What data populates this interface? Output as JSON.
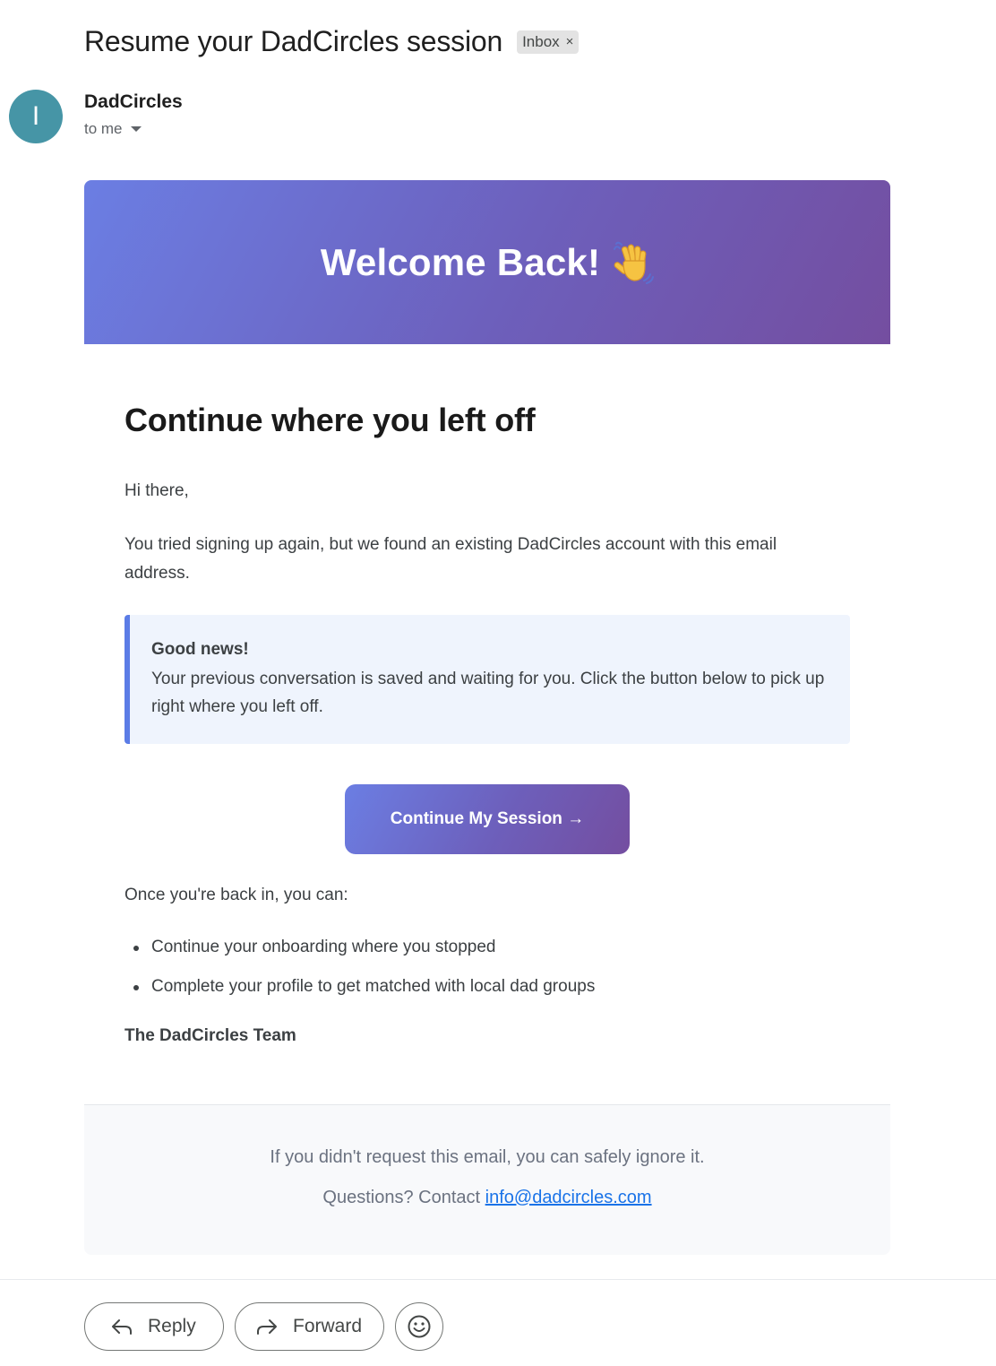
{
  "header": {
    "subject": "Resume your DadCircles session",
    "label": "Inbox",
    "label_remove_glyph": "×"
  },
  "sender": {
    "avatar_initial": "I",
    "name": "DadCircles",
    "recipient": "to me",
    "avatar_color": "#4695a6"
  },
  "email": {
    "hero_title": "Welcome Back!",
    "hero_emoji_icon": "waving-hand-icon",
    "heading": "Continue where you left off",
    "greeting": "Hi there,",
    "intro": "You tried signing up again, but we found an existing DadCircles account with this email address.",
    "callout_title": "Good news!",
    "callout_text": "Your previous conversation is saved and waiting for you. Click the button below to pick up right where you left off.",
    "cta_label": "Continue My Session →",
    "once_text": "Once you're back in, you can:",
    "bullets": [
      "Continue your onboarding where you stopped",
      "Complete your profile to get matched with local dad groups"
    ],
    "signature": "The DadCircles Team",
    "footer_line1": "If you didn't request this email, you can safely ignore it.",
    "footer_line2_prefix": "Questions? Contact ",
    "footer_email": "info@dadcircles.com",
    "accent_gradient_start": "#6b7ee3",
    "accent_gradient_end": "#744ea0",
    "callout_border_color": "#5b7ce6"
  },
  "actions": {
    "reply_label": "Reply",
    "forward_label": "Forward",
    "emoji_icon": "smiley-icon"
  }
}
